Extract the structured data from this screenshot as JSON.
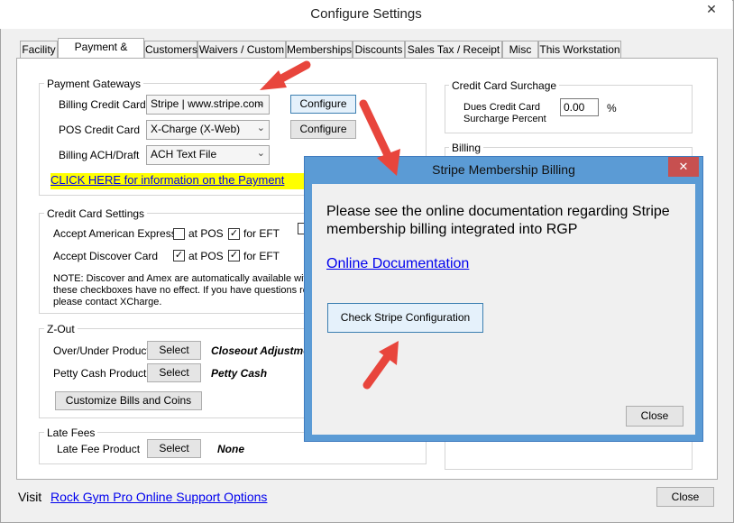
{
  "window": {
    "title": "Configure Settings",
    "close_glyph": "✕"
  },
  "tabs": [
    "Facility",
    "Payment & Billing",
    "Customers",
    "Waivers / Custom",
    "Memberships",
    "Discounts",
    "Sales Tax / Receipt",
    "Misc",
    "This Workstation"
  ],
  "payment_gateways": {
    "label": "Payment Gateways",
    "rows": [
      {
        "label": "Billing Credit Card",
        "value": "Stripe | www.stripe.com",
        "button": "Configure"
      },
      {
        "label": "POS Credit Card",
        "value": "X-Charge (X-Web)",
        "button": "Configure"
      },
      {
        "label": "Billing ACH/Draft",
        "value": "ACH Text File"
      }
    ],
    "info_link": "CLICK HERE for information on the Payment"
  },
  "credit_card_settings": {
    "label": "Credit Card Settings",
    "rows": [
      {
        "label": "Accept American Express",
        "at_pos_label": "at POS",
        "at_pos_checked": false,
        "eft_label": "for EFT",
        "eft_checked": true
      },
      {
        "label": "Accept Discover Card",
        "at_pos_label": "at POS",
        "at_pos_checked": true,
        "eft_label": "for EFT",
        "eft_checked": true
      }
    ],
    "note_lines": [
      "NOTE:  Discover and Amex are automatically available with",
      "these checkboxes have no effect.  If you have questions re",
      "please contact XCharge."
    ]
  },
  "zout": {
    "label": "Z-Out",
    "rows": [
      {
        "label": "Over/Under Product",
        "button": "Select",
        "value": "Closeout Adjustme"
      },
      {
        "label": "Petty Cash Product",
        "button": "Select",
        "value": "Petty Cash"
      }
    ],
    "customize_button": "Customize Bills and Coins"
  },
  "late_fees": {
    "label": "Late Fees",
    "row": {
      "label": "Late Fee Product",
      "button": "Select",
      "value": "None"
    }
  },
  "surcharge": {
    "label": "Credit Card Surchage",
    "field_label_1": "Dues Credit Card",
    "field_label_2": "Surcharge Percent",
    "value": "0.00",
    "unit": "%"
  },
  "billing": {
    "label": "Billing"
  },
  "footer": {
    "visit_label": "Visit",
    "support_link": "Rock Gym Pro Online Support Options",
    "close_button": "Close"
  },
  "dialog": {
    "title": "Stripe Membership Billing",
    "close_glyph": "✕",
    "message_line1": "Please see the online documentation regarding Stripe",
    "message_line2": "membership billing integrated into RGP",
    "doc_link": "Online Documentation",
    "check_button": "Check Stripe Configuration",
    "close_button": "Close"
  },
  "colors": {
    "arrow": "#e8453c",
    "highlight": "#ffff00",
    "dialog_border": "#5b9bd5",
    "link": "#0000ee"
  }
}
